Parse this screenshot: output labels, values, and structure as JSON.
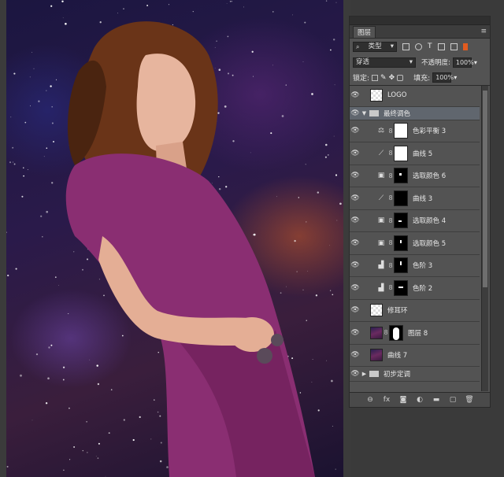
{
  "panel": {
    "tab_label": "图层",
    "filter": {
      "selected": "类型"
    },
    "blend_mode": "穿透",
    "opacity_label": "不透明度:",
    "opacity_value": "100%",
    "lock_label": "锁定:",
    "fill_label": "填充:",
    "fill_value": "100%",
    "layers": [
      {
        "name": "LOGO",
        "kind": "pixel"
      },
      {
        "name": "最终调色",
        "kind": "group"
      },
      {
        "name": "色彩平衡 3",
        "kind": "adjustment",
        "mask": "white"
      },
      {
        "name": "曲线 5",
        "kind": "adjustment",
        "mask": "white"
      },
      {
        "name": "选取颜色 6",
        "kind": "adjustment",
        "mask": "black"
      },
      {
        "name": "曲线 3",
        "kind": "adjustment",
        "mask": "black"
      },
      {
        "name": "选取颜色 4",
        "kind": "adjustment",
        "mask": "black"
      },
      {
        "name": "选取颜色 5",
        "kind": "adjustment",
        "mask": "black"
      },
      {
        "name": "色阶 3",
        "kind": "adjustment",
        "mask": "black"
      },
      {
        "name": "色阶 2",
        "kind": "adjustment",
        "mask": "black"
      },
      {
        "name": "修耳环",
        "kind": "pixel"
      },
      {
        "name": "图层 8",
        "kind": "photo-mask"
      },
      {
        "name": "曲线 7",
        "kind": "photo"
      },
      {
        "name": "初步定调",
        "kind": "group"
      }
    ]
  },
  "colors": {
    "panel_bg": "#535353",
    "group_highlight": "#60666e",
    "dress": "#8a2e72"
  }
}
